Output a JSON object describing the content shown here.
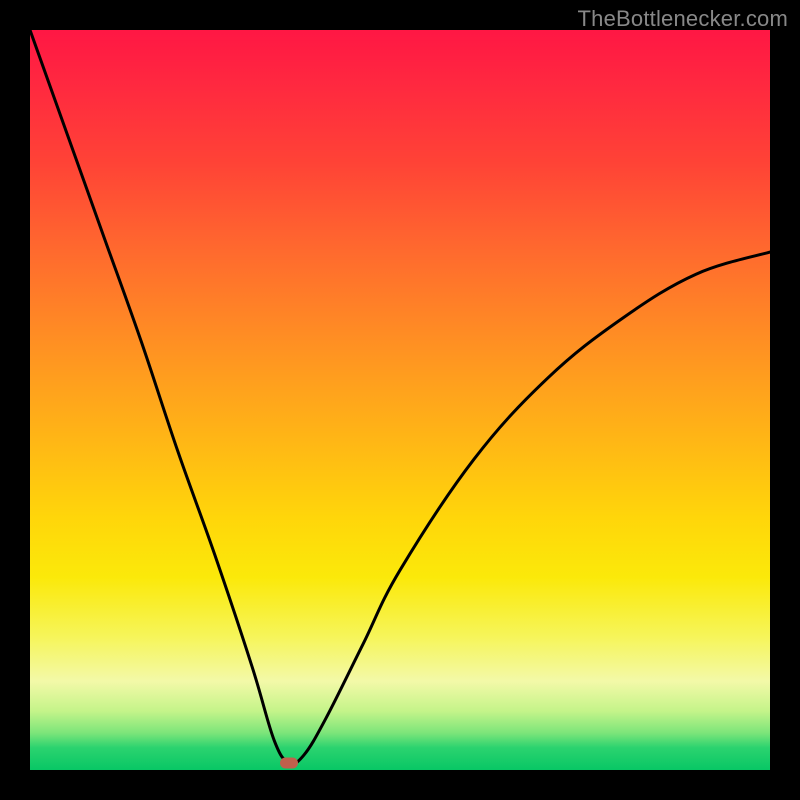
{
  "watermark": {
    "text": "TheBottlenecker.com"
  },
  "chart_data": {
    "type": "line",
    "title": "",
    "xlabel": "",
    "ylabel": "",
    "xlim": [
      0,
      100
    ],
    "ylim": [
      0,
      100
    ],
    "grid": false,
    "background_gradient": [
      "#ff1744",
      "#ff6a2e",
      "#ffd60a",
      "#f3f9a8",
      "#08c765"
    ],
    "series": [
      {
        "name": "bottleneck-curve",
        "x": [
          0,
          5,
          10,
          15,
          20,
          25,
          30,
          33,
          35,
          37,
          40,
          45,
          50,
          60,
          70,
          80,
          90,
          100
        ],
        "y": [
          100,
          86,
          72,
          58,
          43,
          29,
          14,
          4,
          1,
          2,
          7,
          17,
          27,
          42,
          53,
          61,
          67,
          70
        ]
      }
    ],
    "marker": {
      "x": 35,
      "y": 1,
      "color": "#c0604c"
    }
  }
}
